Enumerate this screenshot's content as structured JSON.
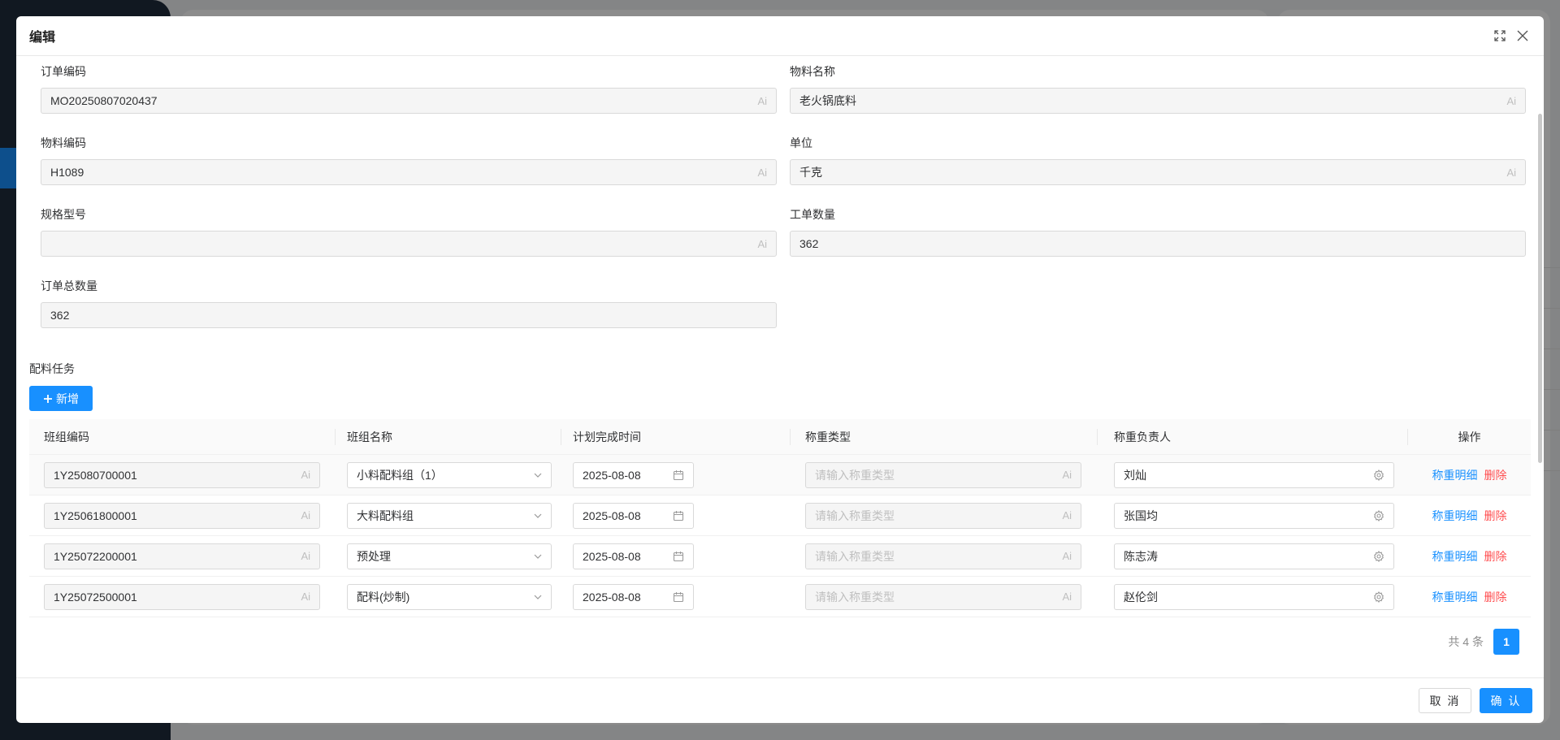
{
  "modal": {
    "title": "编辑"
  },
  "form": {
    "order_code": {
      "label": "订单编码",
      "value": "MO20250807020437",
      "suffix": "Ai"
    },
    "material_name": {
      "label": "物料名称",
      "value": "老火锅底料",
      "suffix": "Ai"
    },
    "material_code": {
      "label": "物料编码",
      "value": "H1089",
      "suffix": "Ai"
    },
    "unit": {
      "label": "单位",
      "value": "千克",
      "suffix": "Ai"
    },
    "spec": {
      "label": "规格型号",
      "value": "",
      "suffix": "Ai"
    },
    "work_order_qty": {
      "label": "工单数量",
      "value": "362"
    },
    "order_total_qty": {
      "label": "订单总数量",
      "value": "362"
    }
  },
  "tasks": {
    "section_title": "配料任务",
    "add_label": "新增",
    "columns": [
      "班组编码",
      "班组名称",
      "计划完成时间",
      "称重类型",
      "称重负责人",
      "操作"
    ],
    "type_placeholder": "请输入称重类型",
    "suffix": "Ai",
    "rows": [
      {
        "code": "1Y25080700001",
        "group": "小料配料组（1）",
        "date": "2025-08-08",
        "person": "刘灿",
        "detail": "称重明细",
        "delete": "删除"
      },
      {
        "code": "1Y25061800001",
        "group": "大料配料组",
        "date": "2025-08-08",
        "person": "张国均",
        "detail": "称重明细",
        "delete": "删除"
      },
      {
        "code": "1Y25072200001",
        "group": "预处理",
        "date": "2025-08-08",
        "person": "陈志涛",
        "detail": "称重明细",
        "delete": "删除"
      },
      {
        "code": "1Y25072500001",
        "group": "配料(炒制)",
        "date": "2025-08-08",
        "person": "赵伦剑",
        "detail": "称重明细",
        "delete": "删除"
      }
    ],
    "total": "共 4 条",
    "page": "1"
  },
  "footer": {
    "cancel": "取 消",
    "confirm": "确 认"
  },
  "colors": {
    "primary": "#1890ff",
    "danger": "#ff4d4f"
  }
}
